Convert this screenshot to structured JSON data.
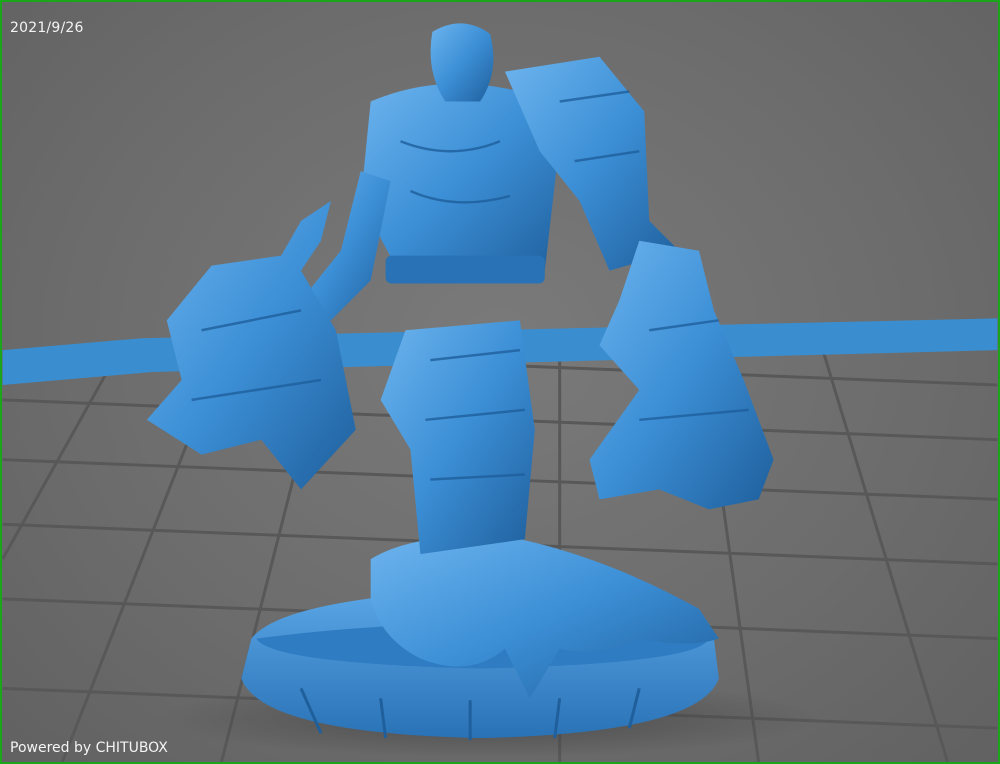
{
  "viewport": {
    "date": "2021/9/26",
    "powered_by": "Powered by CHITUBOX"
  },
  "colors": {
    "model": "#3c8fd6",
    "model_shadow": "#1f5f9c",
    "model_highlight": "#6db4ee",
    "grid_line": "#5a5a5a",
    "plate_edge": "#3a8ed0",
    "border": "#1aa51a"
  }
}
